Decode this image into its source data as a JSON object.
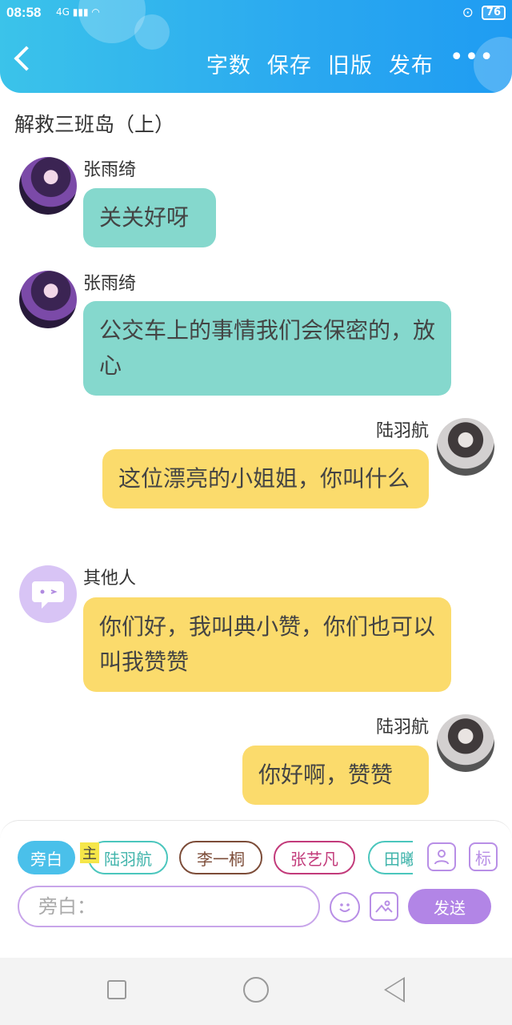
{
  "status_bar": {
    "time": "08:58",
    "network": "4G",
    "battery": "76"
  },
  "header": {
    "menu": [
      "字数",
      "保存",
      "旧版",
      "发布"
    ],
    "more": "•••"
  },
  "title": "解救三班岛（上）",
  "messages": [
    {
      "speaker": "张雨绮",
      "text": "关关好呀",
      "side": "left",
      "color": "#85d8cd"
    },
    {
      "speaker": "张雨绮",
      "text": "公交车上的事情我们会保密的，放心",
      "side": "left",
      "color": "#85d8cd"
    },
    {
      "speaker": "陆羽航",
      "text": "这位漂亮的小姐姐，你叫什么",
      "side": "right",
      "color": "#fbdb6c"
    },
    {
      "speaker": "其他人",
      "text": "你们好，我叫典小赞，你们也可以叫我赞赞",
      "side": "left",
      "color": "#fbdb6c"
    },
    {
      "speaker": "陆羽航",
      "text": "你好啊，赞赞",
      "side": "right",
      "color": "#fbdb6c"
    }
  ],
  "composer": {
    "chips": [
      "旁白",
      "陆羽航",
      "李一桐",
      "张艺凡",
      "田曦"
    ],
    "main_badge": "主",
    "mark_label": "标",
    "placeholder": "旁白：",
    "send_label": "发送"
  }
}
